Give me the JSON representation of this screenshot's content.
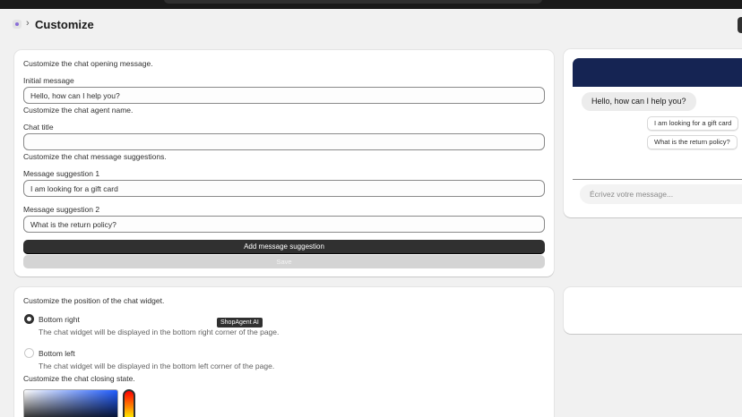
{
  "header": {
    "title": "Customize",
    "chevron": "›"
  },
  "opening": {
    "section_title": "Customize the chat opening message.",
    "initial_label": "Initial message",
    "initial_value": "Hello, how can I help you?",
    "agent_name_title": "Customize the chat agent name.",
    "chat_title_label": "Chat title",
    "chat_title_value": "",
    "suggestions_title": "Customize the chat message suggestions.",
    "suggestion1_label": "Message suggestion 1",
    "suggestion1_value": "I am looking for a gift card",
    "suggestion2_label": "Message suggestion 2",
    "suggestion2_value": "What is the return policy?",
    "add_button": "Add message suggestion",
    "save_button": "Save"
  },
  "position": {
    "section_title": "Customize the position of the chat widget.",
    "options": [
      {
        "label": "Bottom right",
        "description": "The chat widget will be displayed in the bottom right corner of the page.",
        "selected": true
      },
      {
        "label": "Bottom left",
        "description": "The chat widget will be displayed in the bottom left corner of the page.",
        "selected": false
      }
    ],
    "closing_title": "Customize the chat closing state."
  },
  "tooltip": "ShopAgent AI",
  "preview": {
    "header_color": "#152453",
    "greeting": "Hello, how can I help you?",
    "suggestions": [
      "I am looking for a gift card",
      "What is the return policy?"
    ],
    "input_placeholder": "Écrivez votre message..."
  }
}
